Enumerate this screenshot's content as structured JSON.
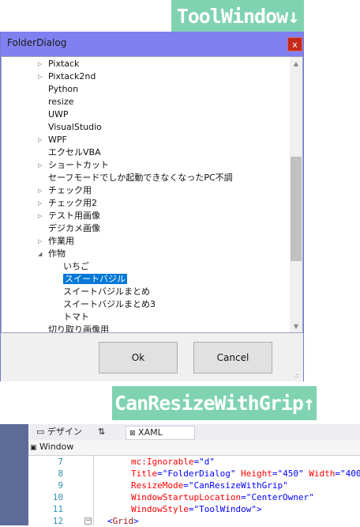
{
  "banners": {
    "top": "ToolWindow↓",
    "bottom": "CanResizeWithGrip↑"
  },
  "dialog": {
    "title": "FolderDialog",
    "close_label": "x",
    "tree_items": [
      {
        "label": "Pixtack",
        "arrow": "▷",
        "level": 0
      },
      {
        "label": "Pixtack2nd",
        "arrow": "▷",
        "level": 0
      },
      {
        "label": "Python",
        "arrow": "",
        "level": 0
      },
      {
        "label": "resize",
        "arrow": "",
        "level": 0
      },
      {
        "label": "UWP",
        "arrow": "",
        "level": 0
      },
      {
        "label": "VisualStudio",
        "arrow": "",
        "level": 0
      },
      {
        "label": "WPF",
        "arrow": "▷",
        "level": 0
      },
      {
        "label": "エクセルVBA",
        "arrow": "",
        "level": 0
      },
      {
        "label": "ショートカット",
        "arrow": "▷",
        "level": 0
      },
      {
        "label": "セーフモードでしか起動できなくなったPC不調",
        "arrow": "",
        "level": 0
      },
      {
        "label": "チェック用",
        "arrow": "▷",
        "level": 0
      },
      {
        "label": "チェック用2",
        "arrow": "▷",
        "level": 0
      },
      {
        "label": "テスト用画像",
        "arrow": "▷",
        "level": 0
      },
      {
        "label": "デジカメ画像",
        "arrow": "",
        "level": 0
      },
      {
        "label": "作業用",
        "arrow": "▷",
        "level": 0
      },
      {
        "label": "作物",
        "arrow": "◢",
        "level": 0
      },
      {
        "label": "いちご",
        "arrow": "",
        "level": 1
      },
      {
        "label": "スイートバジル",
        "arrow": "",
        "level": 1,
        "selected": true
      },
      {
        "label": "スイートバジルまとめ",
        "arrow": "",
        "level": 1
      },
      {
        "label": "スイートバジルまとめ3",
        "arrow": "",
        "level": 1
      },
      {
        "label": "トマト",
        "arrow": "",
        "level": 1
      },
      {
        "label": "切り取り画像用",
        "arrow": "",
        "level": 0
      }
    ],
    "ok_label": "Ok",
    "cancel_label": "Cancel",
    "grip_glyph": ".::"
  },
  "editor": {
    "tabs": {
      "design": "デザイン",
      "swap": "⇅",
      "xaml": "XAML"
    },
    "subbar_label": "Window",
    "lines": [
      {
        "num": "7",
        "attr": "mc:Ignorable",
        "val": "\"d\""
      },
      {
        "num": "8",
        "parts": [
          {
            "attr": "Title",
            "val": "\"FolderDialog\""
          },
          {
            "attr": "Height",
            "val": "\"450\""
          },
          {
            "attr": "Width",
            "val": "\"400\""
          }
        ]
      },
      {
        "num": "9",
        "attr": "ResizeMode",
        "val": "\"CanResizeWithGrip\""
      },
      {
        "num": "10",
        "attr": "WindowStartupLocation",
        "val": "\"CenterOwner\""
      },
      {
        "num": "11",
        "attr": "WindowStyle",
        "val": "\"ToolWindow\"",
        "close": ">"
      },
      {
        "num": "12",
        "open": "<",
        "tag": "Grid",
        "close": ">"
      }
    ]
  },
  "colors": {
    "banner": "#7fd3b1",
    "titlebar": "#8080f0",
    "selection": "#0078d7"
  }
}
